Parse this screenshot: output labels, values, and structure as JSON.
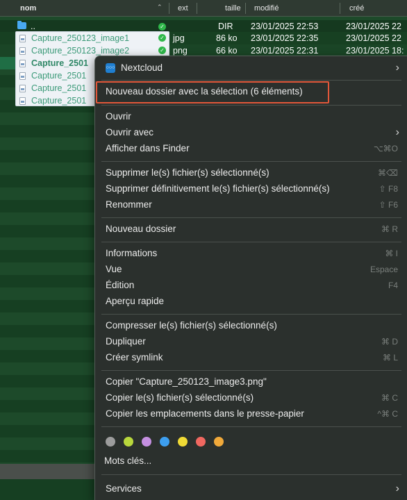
{
  "file_list": {
    "columns": {
      "name": "nom",
      "ext": "ext",
      "size": "taille",
      "modified": "modifié",
      "created": "créé"
    },
    "sort_indicator": "⌃",
    "parent_row": {
      "name": "..",
      "ext": "",
      "size": "DIR",
      "modified": "23/01/2025 22:53",
      "created": "23/01/2025 22"
    },
    "rows": [
      {
        "name": "Capture_250123_image1",
        "ext": "jpg",
        "size": "86 ko",
        "modified": "23/01/2025 22:35",
        "created": "23/01/2025 22"
      },
      {
        "name": "Capture_250123_image2",
        "ext": "png",
        "size": "66 ko",
        "modified": "23/01/2025 22:31",
        "created": "23/01/2025 18:"
      },
      {
        "name": "Capture_2501"
      },
      {
        "name": "Capture_2501"
      },
      {
        "name": "Capture_2501"
      },
      {
        "name": "Capture_2501"
      }
    ]
  },
  "context_menu": {
    "nextcloud": {
      "label": "Nextcloud",
      "icon": "nextcloud-icon",
      "icon_text": "○○○"
    },
    "new_folder_with_selection": "Nouveau dossier avec la sélection (6 éléments)",
    "open": "Ouvrir",
    "open_with": "Ouvrir avec",
    "show_in_finder": {
      "label": "Afficher dans Finder",
      "shortcut": "⌥⌘O"
    },
    "delete": {
      "label": "Supprimer le(s) fichier(s) sélectionné(s)",
      "shortcut": "⌘⌫"
    },
    "delete_permanently": {
      "label": "Supprimer définitivement le(s) fichier(s) sélectionné(s)",
      "shortcut": "⇧ F8"
    },
    "rename": {
      "label": "Renommer",
      "shortcut": "⇧ F6"
    },
    "new_folder": {
      "label": "Nouveau dossier",
      "shortcut": "⌘ R"
    },
    "info": {
      "label": "Informations",
      "shortcut": "⌘ I"
    },
    "view": {
      "label": "Vue",
      "shortcut": "Espace"
    },
    "edit": {
      "label": "Édition",
      "shortcut": "F4"
    },
    "quick_look": "Aperçu rapide",
    "compress": "Compresser le(s) fichier(s) sélectionné(s)",
    "duplicate": {
      "label": "Dupliquer",
      "shortcut": "⌘ D"
    },
    "symlink": {
      "label": "Créer symlink",
      "shortcut": "⌘ L"
    },
    "copy_name": "Copier \"Capture_250123_image3.png\"",
    "copy_files": {
      "label": "Copier le(s) fichier(s) sélectionné(s)",
      "shortcut": "⌘ C"
    },
    "copy_paths": {
      "label": "Copier les emplacements dans le presse-papier",
      "shortcut": "^⌘ C"
    },
    "tags": [
      "#9c9c9c",
      "#b8d73c",
      "#c48fe0",
      "#3d9ff0",
      "#f0da35",
      "#f06860",
      "#f0a93a"
    ],
    "tags_label": "Mots clés...",
    "services": "Services",
    "submenu_arrow": "›"
  },
  "colors": {
    "highlight_border": "#e2573a",
    "row_highlight": "#1f6e45"
  }
}
